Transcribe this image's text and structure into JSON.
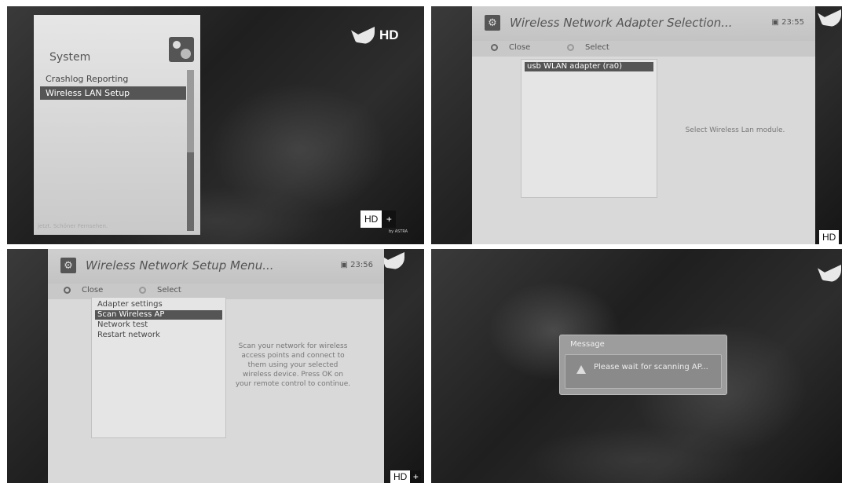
{
  "panel1": {
    "hd_logo": "HD",
    "title": "System",
    "items": [
      "Crashlog Reporting",
      "Wireless LAN Setup"
    ],
    "selected_index": 1,
    "footer": "jetzt. Schöner Fernsehen.",
    "hdplus_label": "HD",
    "hdplus_plus": "+",
    "hdplus_by": "by ASTRA"
  },
  "panel2": {
    "title": "Wireless Network Adapter Selection...",
    "clock": "23:55",
    "close_label": "Close",
    "select_label": "Select",
    "items": [
      "usb WLAN adapter (ra0)"
    ],
    "help": "Select Wireless Lan module.",
    "hd_corner": "HD"
  },
  "panel3": {
    "title": "Wireless Network Setup Menu...",
    "clock": "23:56",
    "close_label": "Close",
    "select_label": "Select",
    "items": [
      "Adapter settings",
      "Scan Wireless AP",
      "Network test",
      "Restart network"
    ],
    "selected_index": 1,
    "help": "Scan your network for wireless access points and connect to them using your selected wireless device. Press OK on your remote control to continue.",
    "hd_corner": "HD",
    "hd_plus": "+"
  },
  "panel4": {
    "message_title": "Message",
    "message_text": "Please wait for scanning AP..."
  }
}
